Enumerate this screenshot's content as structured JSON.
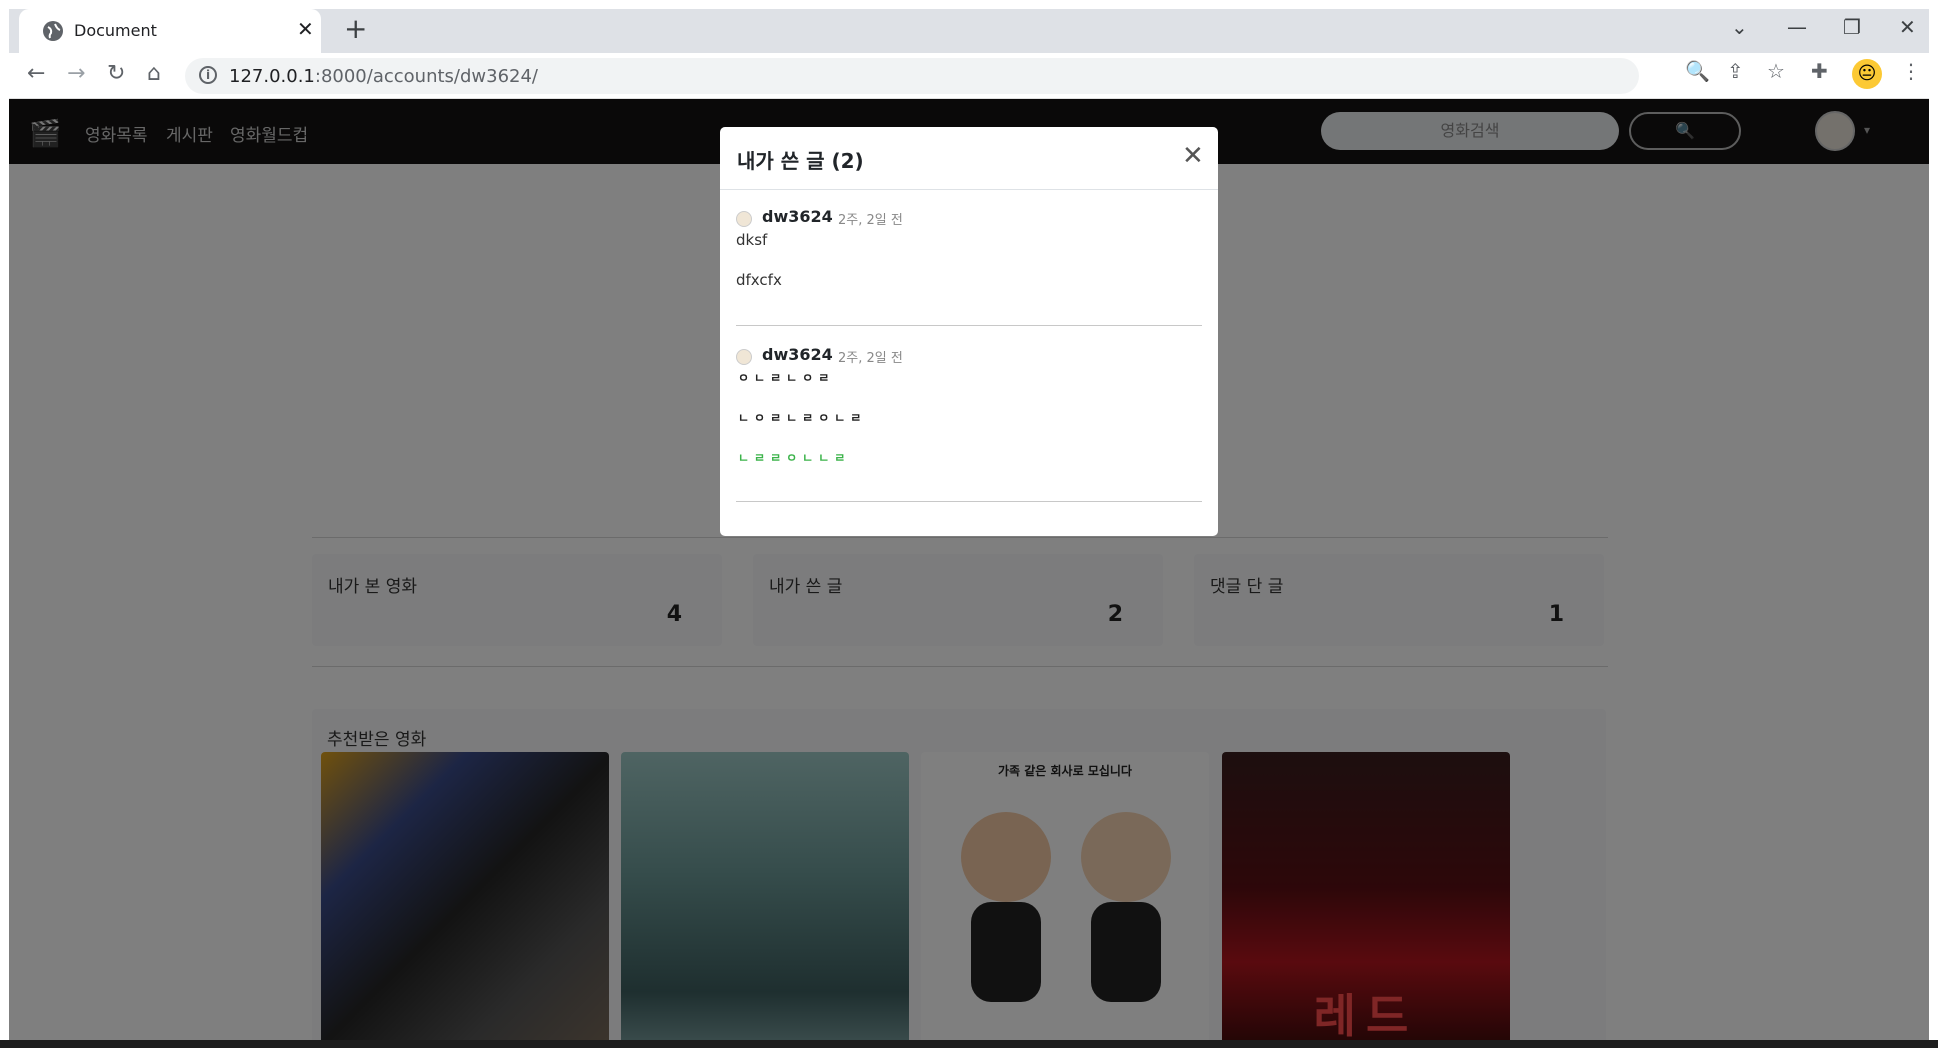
{
  "browser": {
    "tab_title": "Document",
    "url_host": "127.0.0.1",
    "url_rest": ":8000/accounts/dw3624/",
    "new_tab_glyph": "+",
    "close_glyph": "✕",
    "min_glyph": "—",
    "restore_glyph": "❐",
    "dropdown_glyph": "⌄",
    "back_glyph": "←",
    "forward_glyph": "→",
    "reload_glyph": "↻",
    "home_glyph": "⌂",
    "zoom_glyph": "🔍",
    "share_glyph": "⇪",
    "star_glyph": "☆",
    "ext_glyph": "✚",
    "menu_glyph": "⋮",
    "profile_glyph": "😐"
  },
  "site": {
    "logo_glyph": "🎬",
    "nav": [
      "영화목록",
      "게시판",
      "영화월드컵"
    ],
    "search_placeholder": "영화검색",
    "search_button_glyph": "🔍",
    "avatar_caret": "▾"
  },
  "stats": [
    {
      "label": "내가 본 영화",
      "value": "4"
    },
    {
      "label": "내가 쓴 글",
      "value": "2"
    },
    {
      "label": "댓글 단 글",
      "value": "1"
    }
  ],
  "recommended": {
    "label": "추천받은 영화",
    "poster3_tagline": "가족 같은 회사로 모십니다",
    "poster4_title": "레드"
  },
  "modal": {
    "title": "내가 쓴 글 (2)",
    "close_glyph": "✕",
    "posts": [
      {
        "author": "dw3624",
        "time": "2주, 2일 전",
        "line1": "dksf",
        "line2": "dfxcfx"
      },
      {
        "author": "dw3624",
        "time": "2주, 2일 전",
        "line1": "ㅇㄴㄹㄴㅇㄹ",
        "line2": "ㄴㅇㄹㄴㄹㅇㄴㄹ",
        "line3": "ㄴㄹㄹㅇㄴㄴㄹ"
      }
    ]
  },
  "colors": {
    "navbar": "#141312",
    "green_text": "#3bb34a",
    "backdrop": "rgba(0,0,0,0.5)"
  }
}
